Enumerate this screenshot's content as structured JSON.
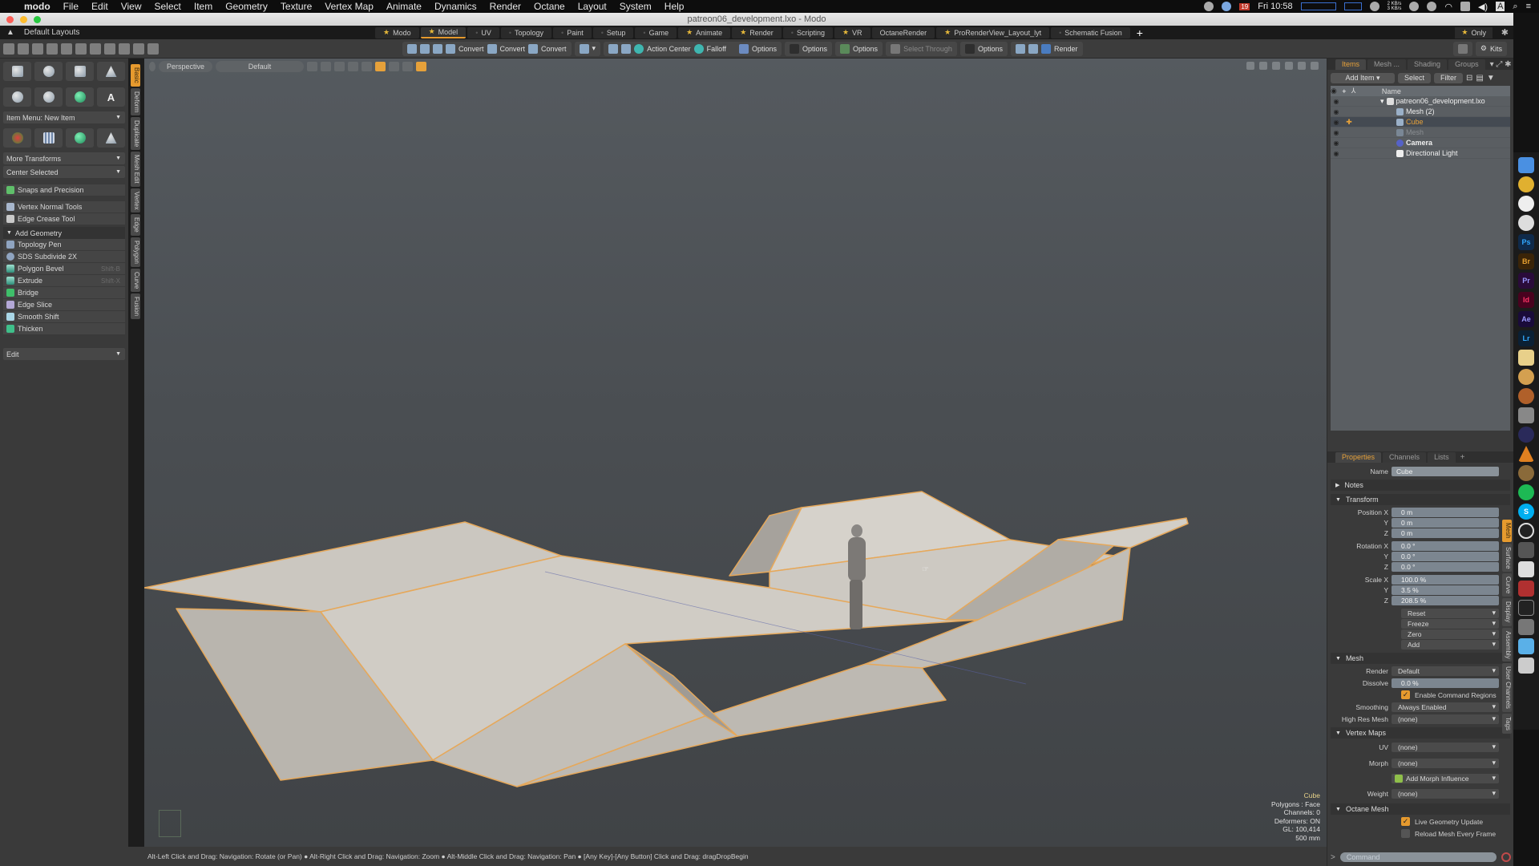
{
  "menubar": {
    "app": "modo",
    "items": [
      "File",
      "Edit",
      "View",
      "Select",
      "Item",
      "Geometry",
      "Texture",
      "Vertex Map",
      "Animate",
      "Dynamics",
      "Render",
      "Octane",
      "Layout",
      "System",
      "Help"
    ],
    "clock": "Fri 10:58",
    "calendar_day": "19",
    "net_up": "2 KB/s",
    "net_down": "3 KB/s"
  },
  "window": {
    "title": "patreon06_development.lxo - Modo"
  },
  "layoutbar": {
    "default_layouts": "Default Layouts",
    "tabs": [
      {
        "label": "Modo",
        "star": true,
        "active": false
      },
      {
        "label": "Model",
        "star": true,
        "active": true
      },
      {
        "label": "UV",
        "star": false,
        "active": false
      },
      {
        "label": "Topology",
        "star": false,
        "active": false
      },
      {
        "label": "Paint",
        "star": false,
        "active": false
      },
      {
        "label": "Setup",
        "star": false,
        "active": false
      },
      {
        "label": "Game",
        "star": false,
        "active": false
      },
      {
        "label": "Animate",
        "star": true,
        "active": false
      },
      {
        "label": "Render",
        "star": true,
        "active": false
      },
      {
        "label": "Scripting",
        "star": false,
        "active": false
      },
      {
        "label": "VR",
        "star": true,
        "active": false
      },
      {
        "label": "OctaneRender",
        "star": false,
        "active": false
      },
      {
        "label": "ProRenderView_Layout_lyt",
        "star": true,
        "active": false
      },
      {
        "label": "Schematic Fusion",
        "star": false,
        "active": false
      }
    ],
    "only_label": "Only"
  },
  "toolbar": {
    "convert1": "Convert",
    "convert2": "Convert",
    "convert3": "Convert",
    "action_center": "Action Center",
    "falloff": "Falloff",
    "options1": "Options",
    "options2": "Options",
    "options3": "Options",
    "select_through": "Select Through",
    "options4": "Options",
    "render": "Render",
    "kits": "Kits"
  },
  "leftpanel": {
    "item_menu": "Item Menu: New Item",
    "more_transforms": "More Transforms",
    "center_selected": "Center Selected",
    "snaps": "Snaps and Precision",
    "vertex_normal": "Vertex Normal Tools",
    "edge_crease": "Edge Crease Tool",
    "add_geometry": "Add Geometry",
    "tools": [
      {
        "label": "Topology Pen",
        "shortcut": ""
      },
      {
        "label": "SDS Subdivide 2X",
        "shortcut": ""
      },
      {
        "label": "Polygon Bevel",
        "shortcut": "Shift-B"
      },
      {
        "label": "Extrude",
        "shortcut": "Shift-X"
      },
      {
        "label": "Bridge",
        "shortcut": ""
      },
      {
        "label": "Edge Slice",
        "shortcut": ""
      },
      {
        "label": "Smooth Shift",
        "shortcut": ""
      },
      {
        "label": "Thicken",
        "shortcut": ""
      }
    ],
    "edit_dropdown": "Edit",
    "vtabs": [
      "Basic",
      "Deform",
      "Duplicate",
      "Mesh Edit",
      "Vertex",
      "Edge",
      "Polygon",
      "Curve",
      "Fusion"
    ]
  },
  "viewport": {
    "view": "Perspective",
    "shading": "Default",
    "info": {
      "selected": "Cube",
      "polygons": "Polygons : Face",
      "channels": "Channels: 0",
      "deformers": "Deformers: ON",
      "gl": "GL: 100,414",
      "grid": "500 mm"
    },
    "colors": {
      "mesh_face": "#cbc7c0",
      "mesh_edge": "#e6a85a",
      "shadow": "#9d9a95"
    }
  },
  "statusbar": {
    "hint": "Alt-Left Click and Drag: Navigation: Rotate (or Pan) ● Alt-Right Click and Drag: Navigation: Zoom ● Alt-Middle Click and Drag: Navigation: Pan ● [Any Key]-[Any Button] Click and Drag: dragDropBegin"
  },
  "items_panel": {
    "tabs": [
      {
        "label": "Items",
        "active": true
      },
      {
        "label": "Mesh ...",
        "active": false
      },
      {
        "label": "Shading",
        "active": false
      },
      {
        "label": "Groups",
        "active": false
      }
    ],
    "add_item": "Add Item",
    "select": "Select",
    "filter": "Filter",
    "name_header": "Name",
    "rows": [
      {
        "name": "patreon06_development.lxo",
        "level": 0,
        "selected": false,
        "dim": false
      },
      {
        "name": "Mesh (2)",
        "level": 1,
        "selected": false,
        "dim": false
      },
      {
        "name": "Cube",
        "level": 1,
        "selected": true,
        "dim": false
      },
      {
        "name": "Mesh",
        "level": 1,
        "selected": false,
        "dim": true
      },
      {
        "name": "Camera",
        "level": 1,
        "selected": false,
        "dim": false
      },
      {
        "name": "Directional Light",
        "level": 1,
        "selected": false,
        "dim": false
      }
    ]
  },
  "properties_panel": {
    "tabs": [
      {
        "label": "Properties",
        "active": true
      },
      {
        "label": "Channels",
        "active": false
      },
      {
        "label": "Lists",
        "active": false
      }
    ],
    "name_label": "Name",
    "name_value": "Cube",
    "notes": "Notes",
    "transform": "Transform",
    "position": {
      "label": "Position X",
      "x": "0 m",
      "y": "0 m",
      "z": "0 m"
    },
    "rotation": {
      "label": "Rotation X",
      "x": "0.0 °",
      "y": "0.0 °",
      "z": "0.0 °"
    },
    "scale": {
      "label": "Scale X",
      "x": "100.0 %",
      "y": "3.5 %",
      "z": "208.5 %"
    },
    "axis_y": "Y",
    "axis_z": "Z",
    "actions": [
      "Reset",
      "Freeze",
      "Zero",
      "Add"
    ],
    "mesh": "Mesh",
    "render_label": "Render",
    "render_value": "Default",
    "dissolve_label": "Dissolve",
    "dissolve_value": "0.0 %",
    "enable_cmd_regions": "Enable Command Regions",
    "smoothing_label": "Smoothing",
    "smoothing_value": "Always Enabled",
    "highres_label": "High Res Mesh",
    "highres_value": "(none)",
    "vertex_maps": "Vertex Maps",
    "uv_label": "UV",
    "uv_value": "(none)",
    "morph_label": "Morph",
    "morph_value": "(none)",
    "add_morph": "Add Morph Influence",
    "weight_label": "Weight",
    "weight_value": "(none)",
    "octane_mesh": "Octane Mesh",
    "live_geo": "Live Geometry Update",
    "reload_mesh": "Reload Mesh Every Frame",
    "vtabs": [
      "Mesh",
      "Surface",
      "Curve",
      "Display",
      "Assembly",
      "User Channels",
      "Tags"
    ],
    "command_placeholder": "Command"
  },
  "dock": {
    "apps": [
      "Finder",
      "Chrome",
      "Safari",
      "Chrome Canary",
      "Ps",
      "Br",
      "Pr",
      "Id",
      "Ae",
      "Lr",
      "Photos",
      "Music",
      "DaVinci",
      "Rocket",
      "Player",
      "VLC",
      "Speaker",
      "Spotify",
      "Skype",
      "OBS",
      "Clip",
      "Script",
      "Edit",
      "Piano",
      "Prefs",
      "Folder",
      "Trash"
    ]
  }
}
